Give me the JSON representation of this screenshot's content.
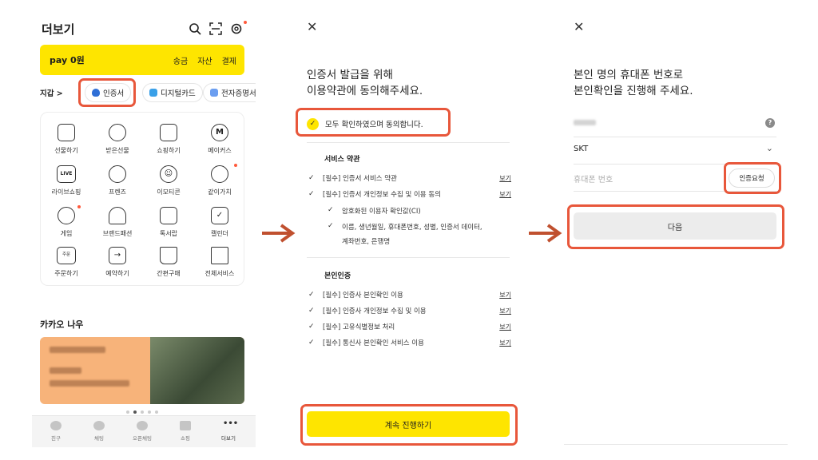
{
  "panel1": {
    "title": "더보기",
    "pay": {
      "logo": "pay 0원",
      "actions": [
        "송금",
        "자산",
        "결제"
      ]
    },
    "chips": [
      "지갑 >",
      "인증서",
      "디지털카드",
      "전자증명서"
    ],
    "services": [
      "선물하기",
      "받은선물",
      "쇼핑하기",
      "메이커스",
      "라이브쇼핑",
      "프렌즈",
      "이모티콘",
      "같이가치",
      "게임",
      "브랜드패션",
      "톡서랍",
      "캘린더",
      "주문하기",
      "예약하기",
      "간편구매",
      "전체서비스"
    ],
    "live_icon_text": "LIVE",
    "order_icon_text": "주문",
    "now_title": "카카오 나우",
    "tabs": [
      "친구",
      "채팅",
      "오픈채팅",
      "쇼핑",
      "더보기"
    ]
  },
  "panel2": {
    "heading_line1": "인증서 발급을 위해",
    "heading_line2": "이용약관에 동의해주세요.",
    "agree_all": "모두 확인하였으며 동의합니다.",
    "section1_title": "서비스 약관",
    "section1_terms": [
      "[필수] 인증서 서비스 약관",
      "[필수] 인증서 개인정보 수집 및 이용 동의"
    ],
    "section1_sub": [
      "암호화된 이용자 확인값(CI)",
      "이름, 생년월일, 휴대폰번호, 성별, 인증서 데이터,"
    ],
    "section1_sub_cont": "계좌번호, 은행명",
    "section2_title": "본인인증",
    "section2_terms": [
      "[필수] 인증사 본인확인 이용",
      "[필수] 인증사 개인정보 수집 및 이용",
      "[필수] 고유식별정보 처리",
      "[필수] 통신사 본인확인 서비스 이용"
    ],
    "view_label": "보기",
    "continue_label": "계속 진행하기"
  },
  "panel3": {
    "heading_line1": "본인 명의 휴대폰 번호로",
    "heading_line2": "본인확인을 진행해 주세요.",
    "carrier": "SKT",
    "phone_placeholder": "휴대폰 번호",
    "verify_label": "인증요청",
    "next_label": "다음"
  },
  "colors": {
    "kakao_yellow": "#fee500",
    "highlight": "#e8573b",
    "arrow": "#c0502f"
  }
}
